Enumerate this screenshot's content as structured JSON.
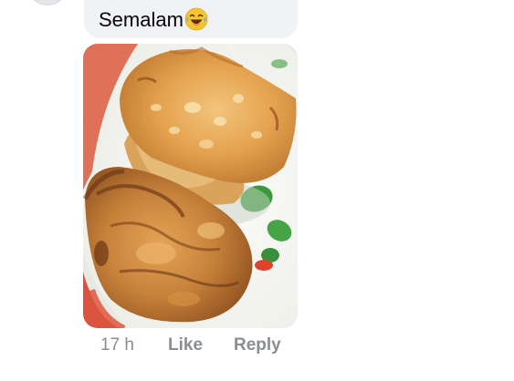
{
  "comment": {
    "text": "Semalam",
    "emoji": "laughing-tears-icon"
  },
  "photo": {
    "subject": "fried-fritters-on-plate"
  },
  "actions": {
    "timestamp": "17 h",
    "like_label": "Like",
    "reply_label": "Reply"
  },
  "colors": {
    "bubble": "#f0f2f5",
    "action_text": "#8a8d91",
    "comment_text": "#050505"
  }
}
